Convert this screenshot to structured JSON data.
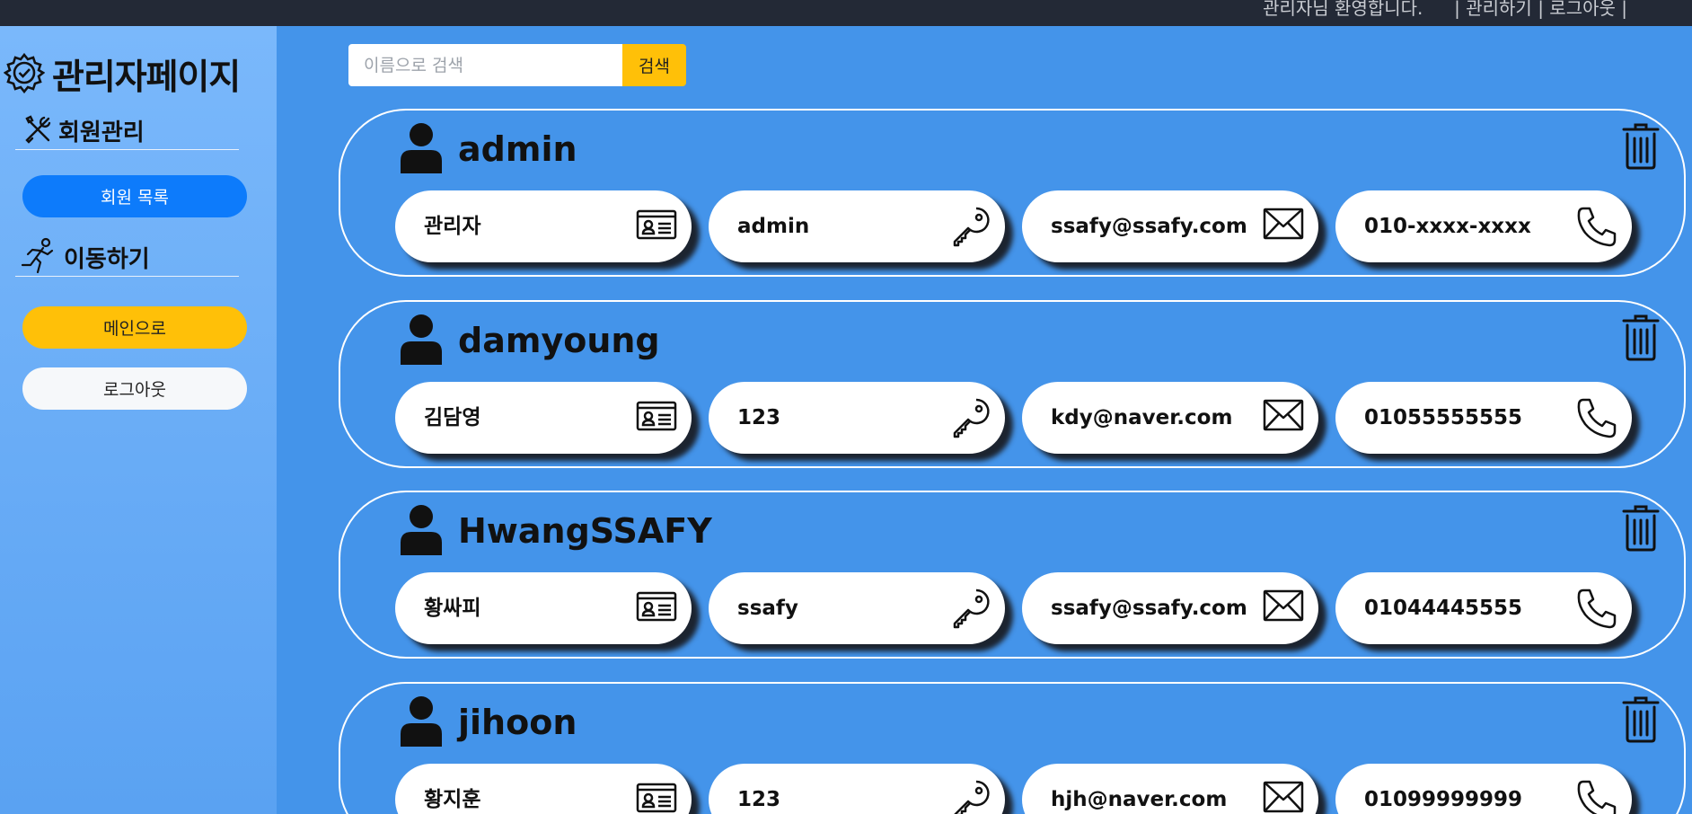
{
  "header": {
    "welcome": "관리자님 환영합니다.",
    "admin_link": "| 관리하기 |",
    "logout_link": "로그아웃 |"
  },
  "sidebar": {
    "brand_title": "관리자페이지",
    "section_member": "회원관리",
    "member_list_button": "회원 목록",
    "section_move": "이동하기",
    "main_button": "메인으로",
    "logout_button": "로그아웃"
  },
  "search": {
    "placeholder": "이름으로 검색",
    "button_label": "검색"
  },
  "members": [
    {
      "id": "admin",
      "name": "관리자",
      "password": "admin",
      "email": "ssafy@ssafy.com",
      "phone": "010-xxxx-xxxx"
    },
    {
      "id": "damyoung",
      "name": "김담영",
      "password": "123",
      "email": "kdy@naver.com",
      "phone": "01055555555"
    },
    {
      "id": "HwangSSAFY",
      "name": "황싸피",
      "password": "ssafy",
      "email": "ssafy@ssafy.com",
      "phone": "01044445555"
    },
    {
      "id": "jihoon",
      "name": "황지훈",
      "password": "123",
      "email": "hjh@naver.com",
      "phone": "01099999999"
    }
  ],
  "icons": {
    "brand": "gear-check-icon",
    "member_section": "tools-icon",
    "move_section": "running-person-icon",
    "user": "user-icon",
    "name_field": "id-card-icon",
    "password_field": "key-icon",
    "email_field": "envelope-icon",
    "phone_field": "phone-icon",
    "delete": "trash-icon"
  },
  "colors": {
    "page_bg": "#4494ea",
    "topbar_bg": "#232936",
    "primary_button": "#0d7bfb",
    "warning_button": "#ffc008",
    "light_button": "#f6f8fa"
  }
}
